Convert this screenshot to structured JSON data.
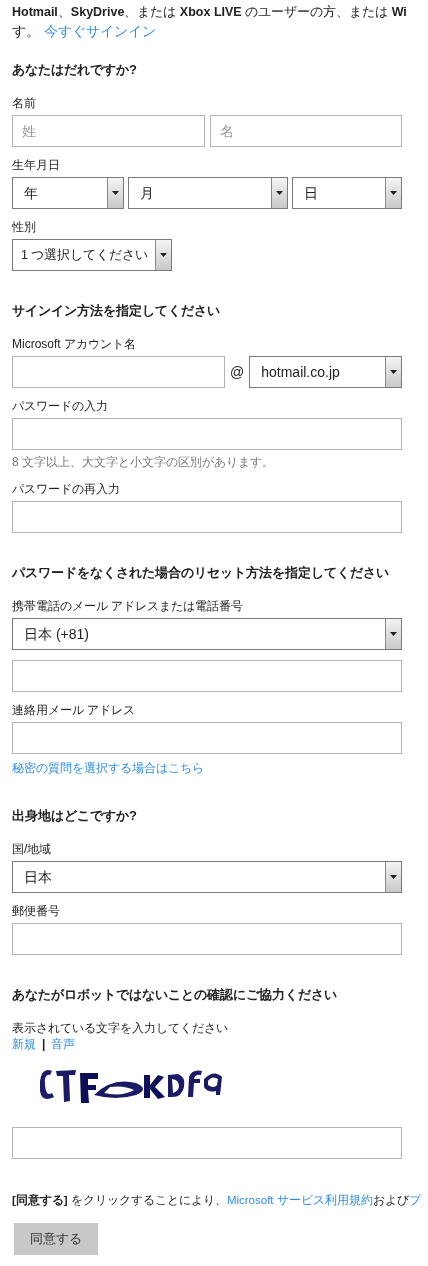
{
  "intro": {
    "line_1": "**Hotmail**、**SkyDrive**、または **Xbox LIVE** のユーザーの方、または **Wi**",
    "line_2": "す。",
    "link": "今すぐサインイン"
  },
  "sections": [
    {
      "heading": "あなたはだれですか?",
      "items": [
        {
          "kind": "label",
          "text": "名前"
        },
        {
          "kind": "pair",
          "fields": [
            {
              "placeholder": "姓"
            },
            {
              "placeholder": "名"
            }
          ]
        },
        {
          "kind": "label",
          "text": "生年月日"
        },
        {
          "kind": "selects",
          "options": [
            {
              "value": "年"
            },
            {
              "value": "月"
            },
            {
              "value": "日"
            }
          ]
        },
        {
          "kind": "label",
          "text": "性別"
        },
        {
          "kind": "select",
          "value": "1 つ選択してください",
          "short": true
        }
      ]
    },
    {
      "heading": "サインイン方法を指定してください",
      "items": [
        {
          "kind": "label",
          "text": "Microsoft アカウント名"
        },
        {
          "kind": "account",
          "at": "@",
          "domain": "hotmail.co.jp"
        },
        {
          "kind": "label",
          "text": "パスワードの入力"
        },
        {
          "kind": "input"
        },
        {
          "kind": "hint",
          "text": "8 文字以上、大文字と小文字の区別があります。"
        },
        {
          "kind": "label",
          "text": "パスワードの再入力"
        },
        {
          "kind": "input"
        }
      ]
    },
    {
      "heading": "パスワードをなくされた場合のリセット方法を指定してください",
      "items": [
        {
          "kind": "label",
          "text": "携帯電話のメール アドレスまたは電話番号"
        },
        {
          "kind": "select",
          "value": "日本 (+81)",
          "short": false
        },
        {
          "kind": "input"
        },
        {
          "kind": "label",
          "text": "連絡用メール アドレス"
        },
        {
          "kind": "input"
        },
        {
          "kind": "link",
          "text": "秘密の質問を選択する場合はこちら"
        }
      ]
    },
    {
      "heading": "出身地はどこですか?",
      "items": [
        {
          "kind": "label",
          "text": "国/地域"
        },
        {
          "kind": "select",
          "value": "日本",
          "short": false
        },
        {
          "kind": "label",
          "text": "郵便番号"
        },
        {
          "kind": "input"
        }
      ]
    },
    {
      "heading": "あなたがロボットではないことの確認にご協力ください",
      "items": [
        {
          "kind": "captcha_label",
          "text": "表示されている文字を入力してください"
        },
        {
          "kind": "captcha_links",
          "links": [
            "新規",
            "音声"
          ],
          "separator": "|"
        },
        {
          "kind": "captcha"
        },
        {
          "kind": "input"
        }
      ]
    }
  ],
  "terms": {
    "bold": "[同意する]",
    "text_1": " をクリックすることにより、",
    "link_1": "Microsoft サービス利用規約",
    "text_2": "および",
    "link_2": "プ"
  },
  "agree_button": "同意する"
}
